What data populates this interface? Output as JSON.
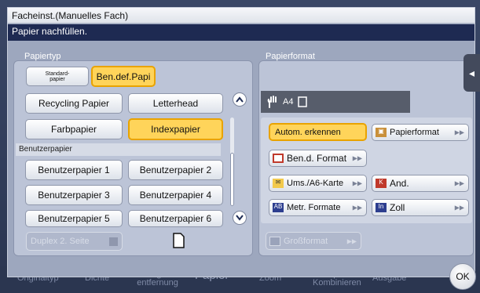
{
  "dialog": {
    "title": "Facheinst.(Manuelles Fach)",
    "message": "Papier nachfüllen."
  },
  "paper_type": {
    "label": "Papiertyp",
    "tabs": {
      "standard_line1": "Standard-",
      "standard_line2": "papier",
      "user_defined": "Ben.def.Papi"
    },
    "buttons": {
      "recycling": "Recycling Papier",
      "letterhead": "Letterhead",
      "farbpapier": "Farbpapier",
      "indexpapier": "Indexpapier"
    },
    "section_user": "Benutzerpapier",
    "user_buttons": {
      "u1": "Benutzerpapier 1",
      "u2": "Benutzerpapier 2",
      "u3": "Benutzerpapier 3",
      "u4": "Benutzerpapier 4",
      "u5": "Benutzerpapier 5",
      "u6": "Benutzerpapier 6"
    },
    "duplex": "Duplex 2. Seite"
  },
  "paper_format": {
    "label": "Papierformat",
    "current": "A4",
    "buttons": {
      "auto_detect": "Autom. erkennen",
      "papierformat": "Papierformat",
      "custom_format": "Ben.d. Format",
      "envelope": "Ums./A6-Karte",
      "other": "And.",
      "metric": "Metr. Formate",
      "inch": "Zoll",
      "large": "Großformat"
    }
  },
  "background_tabs": {
    "t1": "Originaltyp",
    "t2": "Dichte",
    "t3_line1": "Hintergrund-",
    "t3_line2": "entfernung",
    "t4": "Papier",
    "t5": "Zoom",
    "t6_line1": "Duplex/",
    "t6_line2": "Kombinieren",
    "t7": "Ausgabe"
  },
  "ok": "OK",
  "colors": {
    "selected": "#ffd45a",
    "message_bar": "#1e2a52"
  }
}
